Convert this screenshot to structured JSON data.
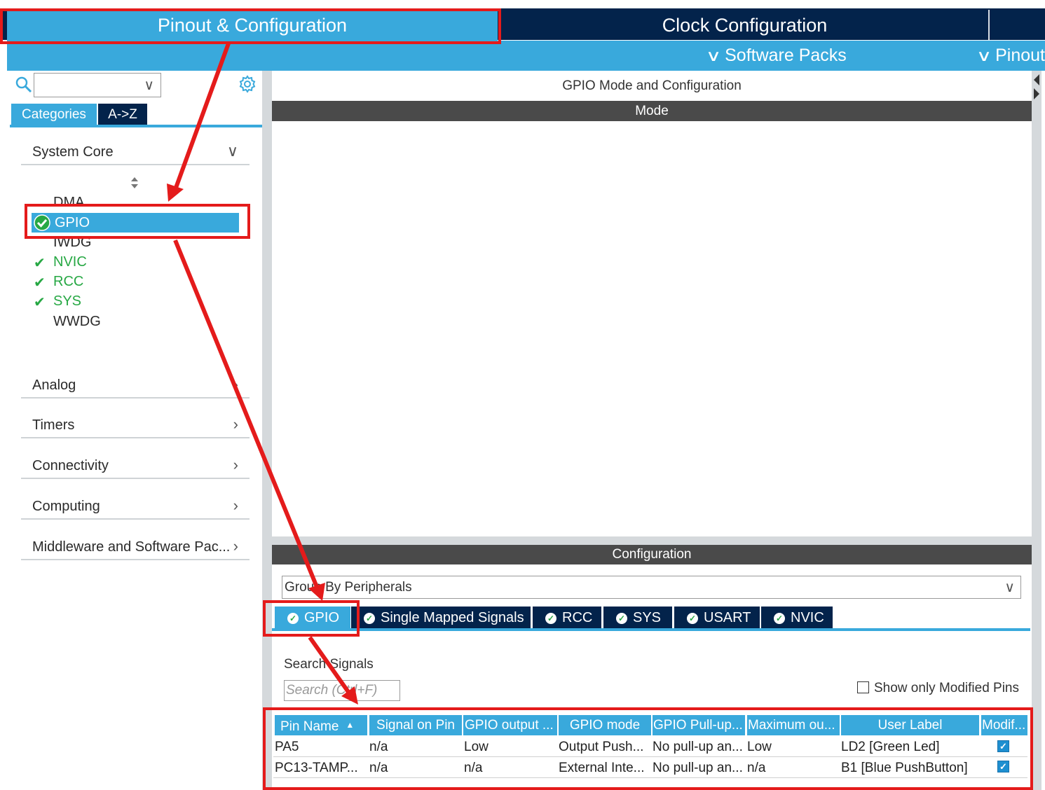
{
  "top_tabs": {
    "pinout": "Pinout & Configuration",
    "clock": "Clock Configuration"
  },
  "sub_menu": {
    "software_packs": "Software Packs",
    "pinout": "Pinout"
  },
  "left": {
    "category_tabs": [
      "Categories",
      "A->Z"
    ],
    "groups": {
      "system_core": "System Core",
      "analog": "Analog",
      "timers": "Timers",
      "connectivity": "Connectivity",
      "computing": "Computing",
      "middleware": "Middleware and Software Pac..."
    },
    "system_core_items": {
      "dma": "DMA",
      "gpio": "GPIO",
      "iwdg": "IWDG",
      "nvic": "NVIC",
      "rcc": "RCC",
      "sys": "SYS",
      "wwdg": "WWDG"
    }
  },
  "main": {
    "title": "GPIO Mode and Configuration",
    "mode_header": "Mode",
    "configuration_header": "Configuration",
    "group_by": "Group By Peripherals",
    "peripheral_tabs": [
      "GPIO",
      "Single Mapped Signals",
      "RCC",
      "SYS",
      "USART",
      "NVIC"
    ],
    "search_label": "Search Signals",
    "search_placeholder": "Search (Ctrl+F)",
    "show_modified_label": "Show only Modified Pins"
  },
  "table": {
    "headers": [
      "Pin Name",
      "Signal on Pin",
      "GPIO output ...",
      "GPIO mode",
      "GPIO Pull-up...",
      "Maximum ou...",
      "User Label",
      "Modif..."
    ],
    "rows": [
      [
        "PA5",
        "n/a",
        "Low",
        "Output Push...",
        "No pull-up an...",
        "Low",
        "LD2 [Green Led]"
      ],
      [
        "PC13-TAMP...",
        "n/a",
        "n/a",
        "External Inte...",
        "No pull-up an...",
        "n/a",
        "B1 [Blue PushButton]"
      ]
    ],
    "modified": [
      true,
      true
    ]
  },
  "colors": {
    "accent_blue": "#39a9dc",
    "dark_navy": "#03234b",
    "header_gray": "#4a4a4a",
    "annotation_red": "#e41b1b",
    "check_green": "#27a844"
  }
}
